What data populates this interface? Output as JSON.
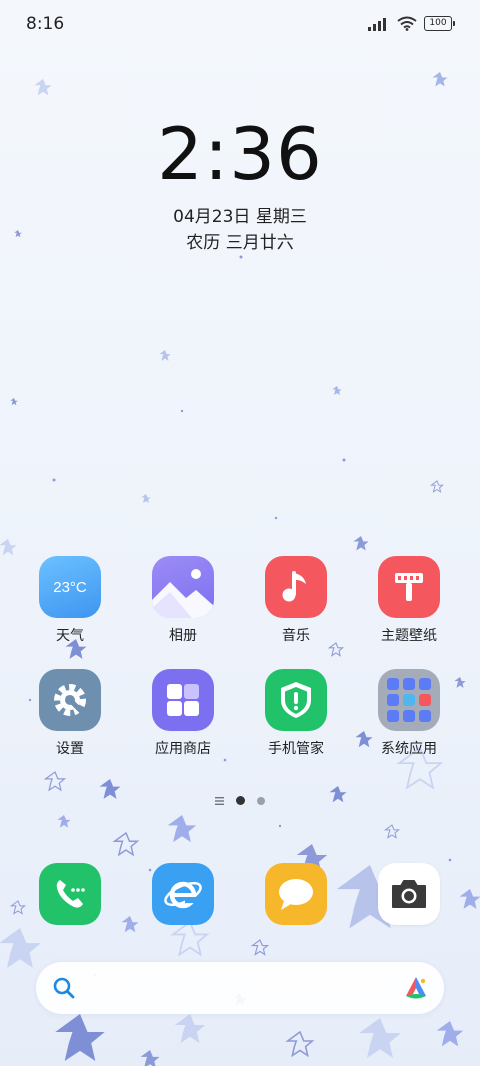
{
  "status_bar": {
    "time": "8:16",
    "battery": "100"
  },
  "lockscreen_widget": {
    "time": "2:36",
    "date": "04月23日 星期三",
    "lunar": "农历 三月廿六"
  },
  "apps": [
    {
      "label": "天气",
      "icon": "weather-icon",
      "temperature": "23°C",
      "color": "#4aa6f5"
    },
    {
      "label": "相册",
      "icon": "gallery-icon",
      "color": "#8a7cf0"
    },
    {
      "label": "音乐",
      "icon": "music-icon",
      "color": "#f5575f"
    },
    {
      "label": "主题壁纸",
      "icon": "themes-icon",
      "color": "#f5575f"
    },
    {
      "label": "设置",
      "icon": "settings-icon",
      "color": "#6f8fae"
    },
    {
      "label": "应用商店",
      "icon": "app-store-icon",
      "color": "#7c6ff0"
    },
    {
      "label": "手机管家",
      "icon": "security-icon",
      "color": "#22c26b"
    },
    {
      "label": "系统应用",
      "icon": "folder-icon",
      "color": "#9aa3b2"
    }
  ],
  "dock": [
    {
      "icon": "phone-icon",
      "color": "#22c26b"
    },
    {
      "icon": "browser-icon",
      "color": "#3aa0f2"
    },
    {
      "icon": "messages-icon",
      "color": "#f7b72b"
    },
    {
      "icon": "camera-icon",
      "color": "#ffffff"
    }
  ],
  "page_indicator": {
    "pages": 2,
    "current": 1
  },
  "search_bar": {
    "icon": "search-icon",
    "assistant_icon": "assistant-icon"
  }
}
